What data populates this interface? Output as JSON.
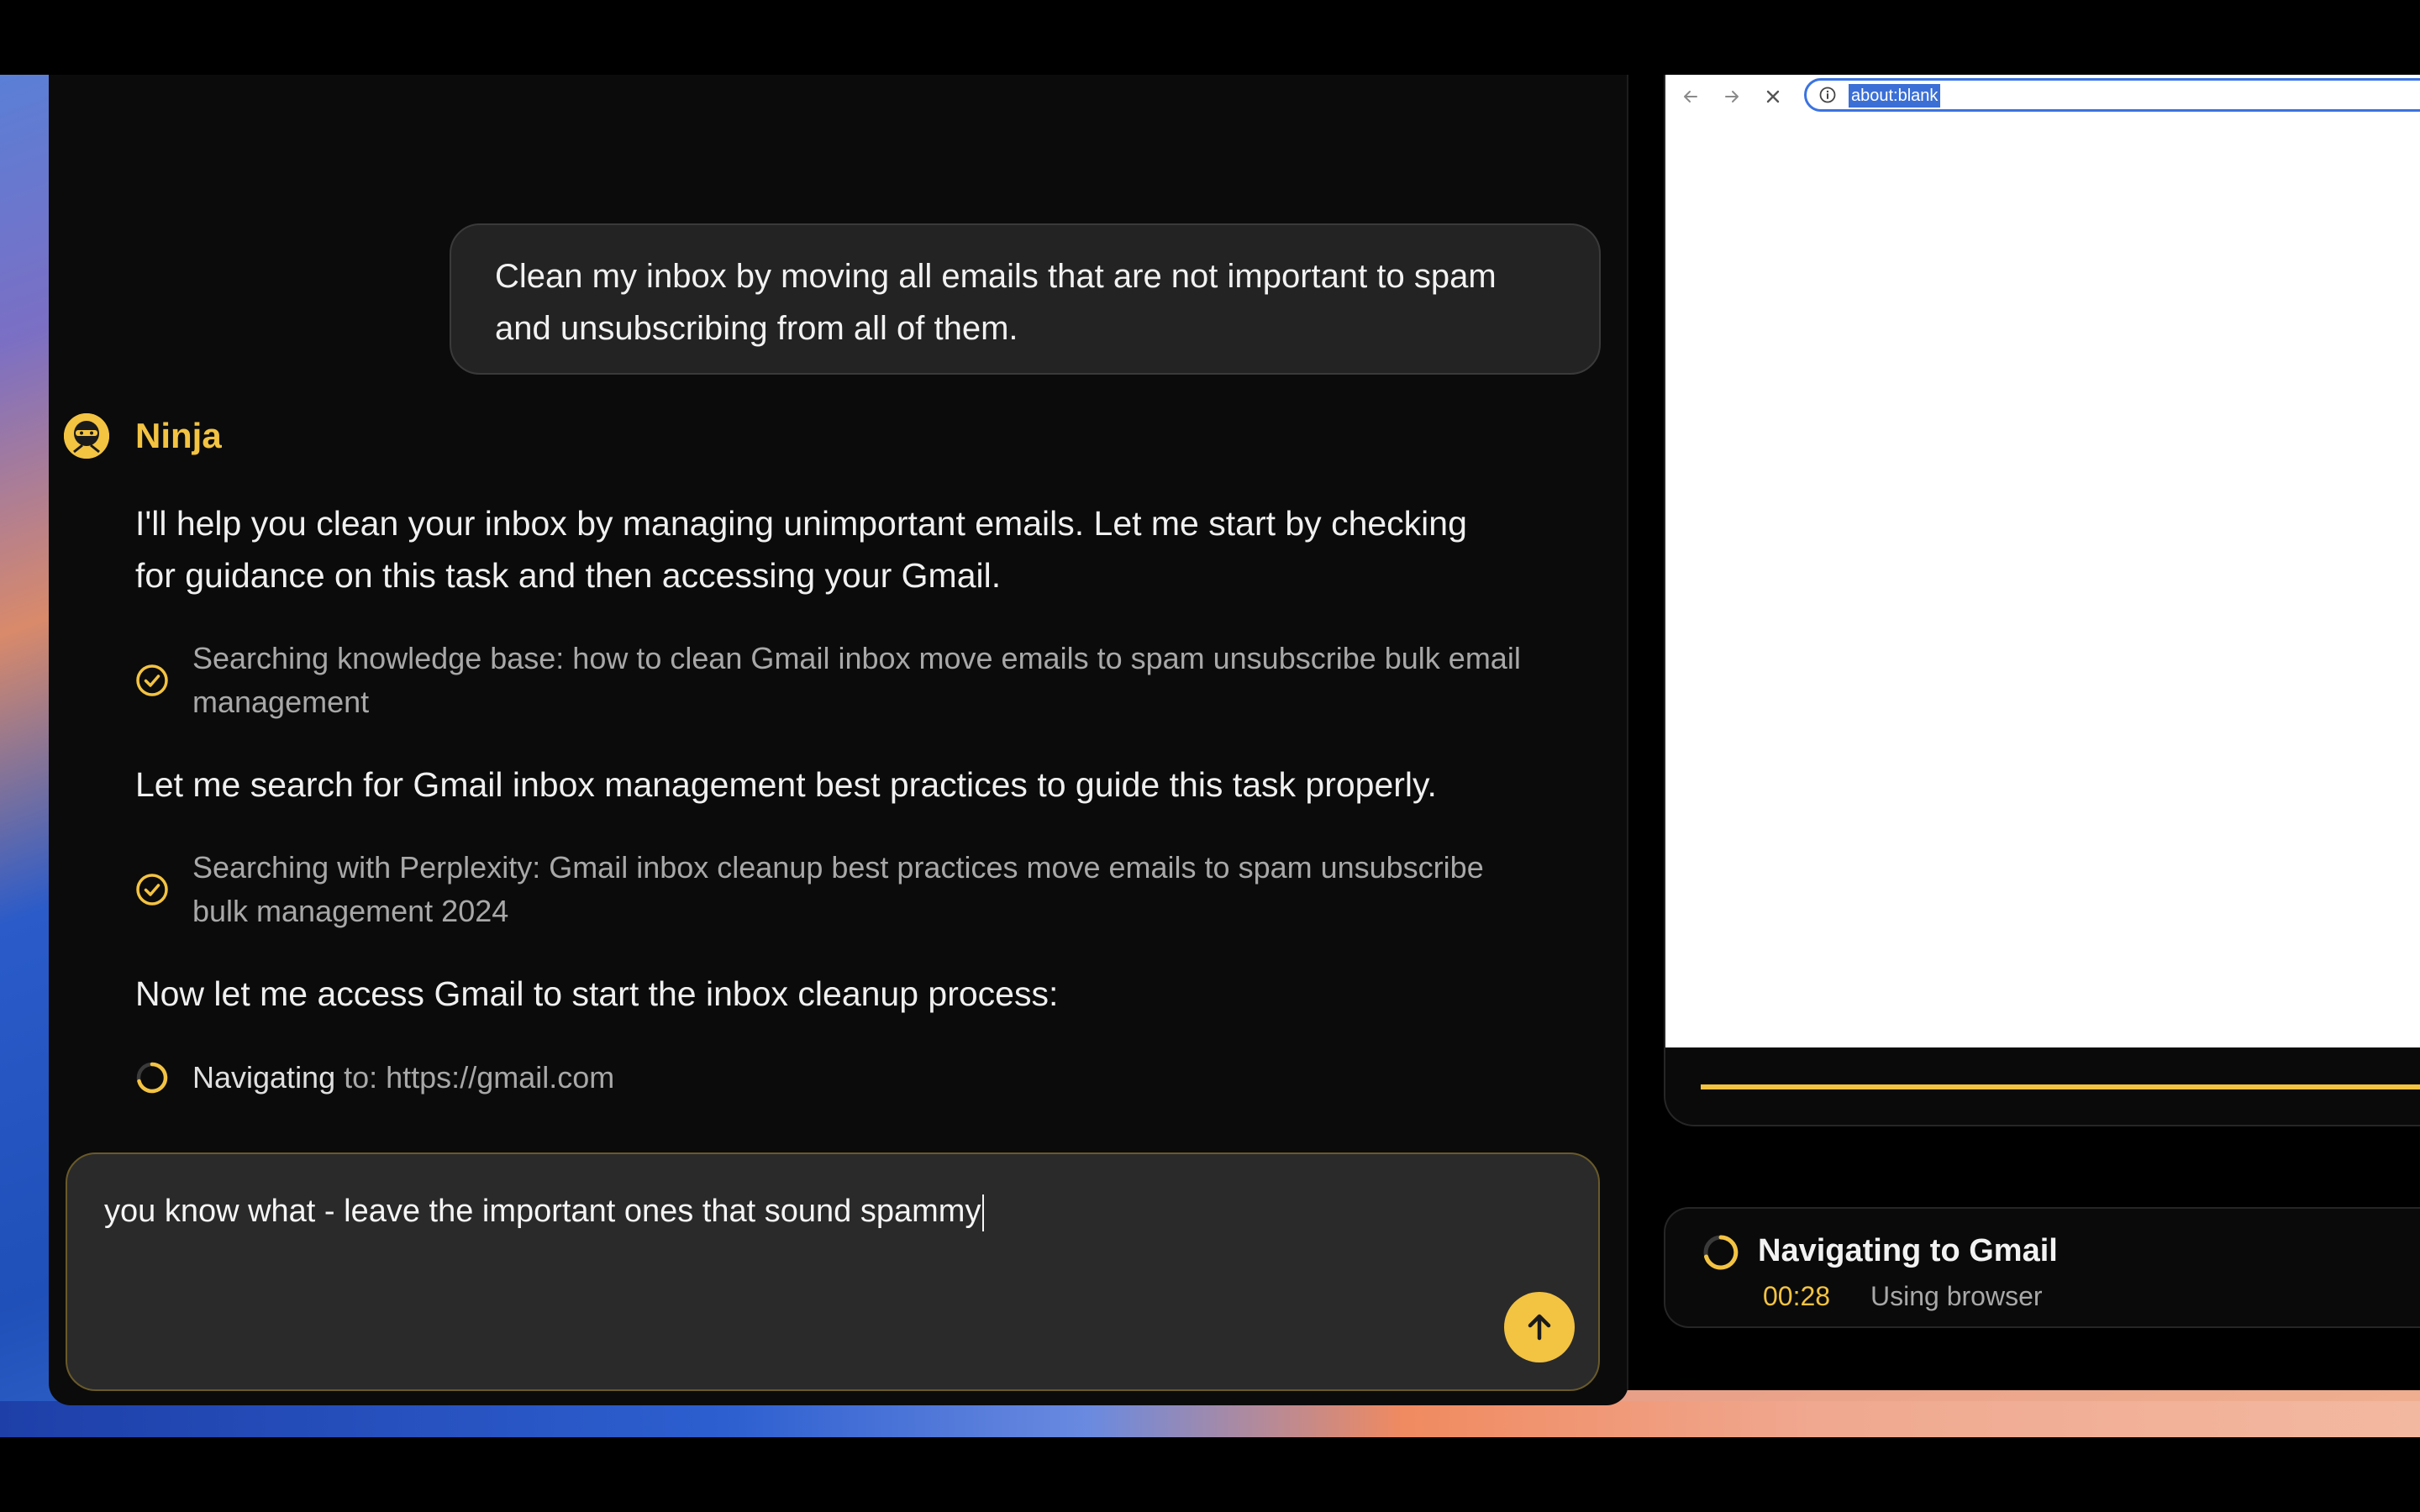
{
  "user_message": {
    "lines": [
      "Clean my inbox by moving all emails that are not important to spam",
      "and unsubscribing from all of them."
    ]
  },
  "agent": {
    "name": "Ninja",
    "icon": "ninja-avatar-icon",
    "messages": [
      [
        "I'll help you clean your inbox by managing unimportant emails. Let me start by checking",
        "for guidance on this task and then accessing your Gmail."
      ],
      [
        "Let me search for Gmail inbox management best practices to guide this task properly."
      ],
      [
        "Now let me access Gmail to start the inbox cleanup process:"
      ]
    ],
    "steps": [
      {
        "status": "done",
        "icon": "check-circle-icon",
        "lines": [
          "Searching knowledge base: how to clean Gmail inbox move emails to spam unsubscribe bulk email",
          "management"
        ]
      },
      {
        "status": "done",
        "icon": "check-circle-icon",
        "lines": [
          "Searching with Perplexity: Gmail inbox cleanup best practices move emails to spam unsubscribe",
          "bulk management 2024"
        ]
      },
      {
        "status": "in-progress",
        "icon": "spinner-icon",
        "prefix": "Navigating",
        "text": " to: https://gmail.com"
      }
    ]
  },
  "composer": {
    "value": "you know what - leave the important ones that sound spammy",
    "send_icon": "arrow-up-icon"
  },
  "browser": {
    "url": "about:blank",
    "progress": 1.0
  },
  "status": {
    "title": "Navigating to Gmail",
    "time": "00:28",
    "tool": "Using browser"
  },
  "colors": {
    "accent": "#f3c342",
    "background": "#0b0b0b",
    "bubble": "#232323",
    "muted_text": "#a8a8a8"
  }
}
